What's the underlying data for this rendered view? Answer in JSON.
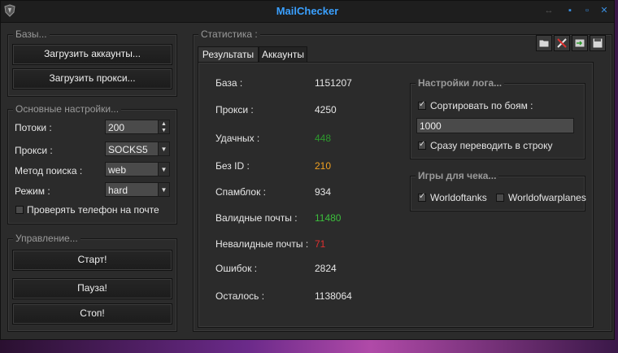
{
  "window": {
    "title": "MailChecker"
  },
  "bases": {
    "title": "Базы...",
    "load_accounts": "Загрузить аккаунты...",
    "load_proxies": "Загрузить прокси..."
  },
  "settings": {
    "title": "Основные настройки...",
    "threads_label": "Потоки :",
    "threads_value": "200",
    "proxy_label": "Прокси :",
    "proxy_value": "SOCKS5",
    "search_label": "Метод поиска :",
    "search_value": "web",
    "mode_label": "Режим  :",
    "mode_value": "hard",
    "check_phone": "Проверять телефон на почте",
    "check_phone_checked": false
  },
  "control": {
    "title": "Управление...",
    "start": "Старт!",
    "pause": "Пауза!",
    "stop": "Стоп!"
  },
  "stats": {
    "title": "Статистика :",
    "tabs": [
      {
        "label": "Результаты",
        "active": true
      },
      {
        "label": "Аккаунты",
        "active": false
      }
    ],
    "toolbar_icons": [
      "folder-icon",
      "tools-icon",
      "export-icon",
      "save-icon"
    ],
    "rows": [
      {
        "label": "База :",
        "value": "1151207",
        "color": "#e6e6e6"
      },
      {
        "label": "Прокси :",
        "value": "4250",
        "color": "#e6e6e6"
      },
      {
        "label": "Удачных :",
        "value": "448",
        "color": "#2d9a2d"
      },
      {
        "label": "Без ID :",
        "value": "210",
        "color": "#f0a020"
      },
      {
        "label": "Спамблок :",
        "value": "934",
        "color": "#e6e6e6"
      },
      {
        "label": "Валидные почты :",
        "value": "11480",
        "color": "#3cbf3c"
      },
      {
        "label": "Невалидные почты :",
        "value": "71",
        "color": "#e03030"
      },
      {
        "label": "Ошибок :",
        "value": "2824",
        "color": "#e6e6e6"
      },
      {
        "label": "Осталось :",
        "value": "1138064",
        "color": "#e6e6e6"
      }
    ]
  },
  "log_settings": {
    "title": "Настройки лога...",
    "sort_label": "Сортировать по боям :",
    "sort_checked": true,
    "sort_value": "1000",
    "instant_label": "Сразу переводить в строку",
    "instant_checked": true
  },
  "games": {
    "title": "Игры для чека...",
    "wot_label": "Worldoftanks",
    "wot_checked": true,
    "wowp_label": "Worldofwarplanes",
    "wowp_checked": false
  }
}
